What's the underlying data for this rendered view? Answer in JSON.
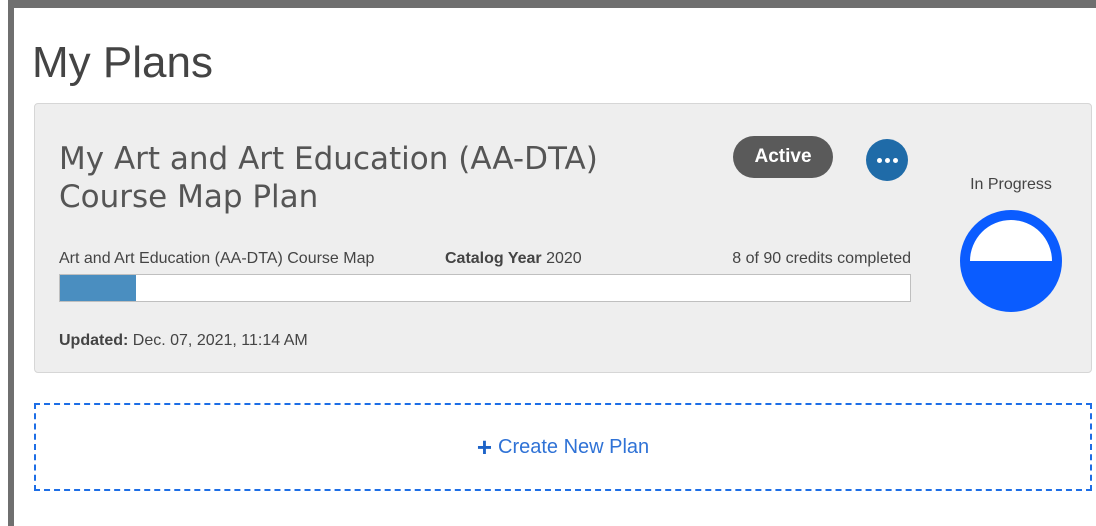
{
  "page": {
    "title": "My Plans"
  },
  "plan_card": {
    "title": "My Art and Art Education (AA-DTA) Course Map Plan",
    "status": "Active",
    "progress_label": "In Progress",
    "map_name": "Art and Art Education (AA-DTA) Course Map",
    "catalog_year_label": "Catalog Year",
    "catalog_year": "2020",
    "credits_text": "8 of 90 credits completed",
    "credits_completed": 8,
    "credits_total": 90,
    "updated_label": "Updated:",
    "updated_value": "Dec. 07, 2021, 11:14 AM",
    "colors": {
      "gauge": "#0a5cff",
      "bar_fill": "#4a8ec0",
      "badge": "#5a5a5a",
      "more_button": "#1f6ba8"
    }
  },
  "create_plan": {
    "icon": "plus-icon",
    "label": "Create New Plan"
  }
}
